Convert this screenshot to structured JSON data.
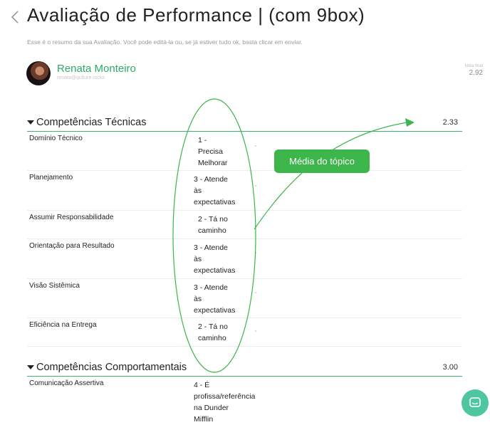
{
  "header": {
    "title": "Avaliação de Performance | (com 9box)",
    "subtitle": "Esse é o resumo da sua Avaliação. Você pode editá-la ou, se já estiver tudo ok, basta clicar em enviar."
  },
  "user": {
    "name": "Renata Monteiro",
    "email": "renata@qulture.rocks"
  },
  "final_grade": {
    "label": "Nota final",
    "value": "2.92"
  },
  "annotation": {
    "label": "Média do tópico"
  },
  "sections": [
    {
      "title": "Competências Técnicas",
      "score": "2.33",
      "rows": [
        {
          "competency": "Domínio Técnico",
          "rating": [
            "1 -",
            "Precisa",
            "Melhorar"
          ]
        },
        {
          "competency": "Planejamento",
          "rating": [
            "3 - Atende",
            "às",
            "expectativas"
          ]
        },
        {
          "competency": "Assumir Responsabilidade",
          "rating": [
            "2 - Tá no",
            "caminho"
          ]
        },
        {
          "competency": "Orientação para Resultado",
          "rating": [
            "3 - Atende",
            "às",
            "expectativas"
          ]
        },
        {
          "competency": "Visão Sistêmica",
          "rating": [
            "3 - Atende",
            "às",
            "expectativas"
          ]
        },
        {
          "competency": "Eficiência na Entrega",
          "rating": [
            "2 - Tá no",
            "caminho"
          ]
        }
      ]
    },
    {
      "title": "Competências Comportamentais",
      "score": "3.00",
      "rows": [
        {
          "competency": "Comunicação Assertiva",
          "rating": [
            "4 - É",
            "profissa/referência",
            "na Dunder",
            "Mifflin"
          ]
        }
      ]
    }
  ],
  "colors": {
    "accent": "#3cb371",
    "annotation": "#3cb54a",
    "chat": "#4ec6a0"
  },
  "icons": {
    "back": "chevron-left-icon",
    "section_toggle": "caret-down-icon",
    "chat": "chat-bubble-icon"
  }
}
